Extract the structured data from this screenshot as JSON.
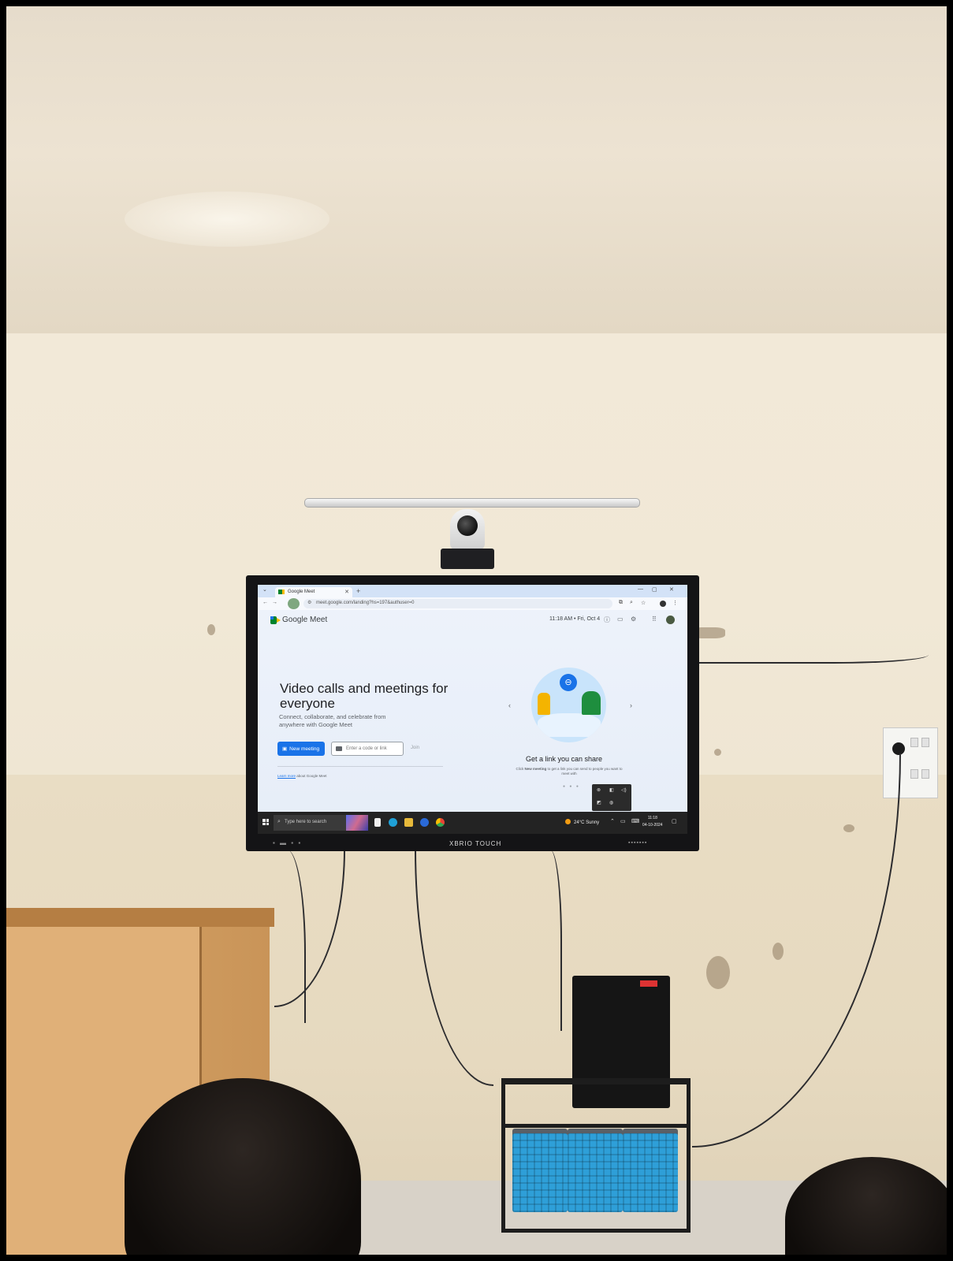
{
  "browser": {
    "tab_title": "Google Meet",
    "url": "meet.google.com/landing?hs=197&authuser=0"
  },
  "meet": {
    "brand": "Google Meet",
    "datetime": "11:18 AM • Fri, Oct 4",
    "hero_title": "Video calls and meetings for everyone",
    "hero_subtitle": "Connect, collaborate, and celebrate from anywhere with Google Meet",
    "new_meeting_label": "New meeting",
    "code_placeholder": "Enter a code or link",
    "join_label": "Join",
    "learn_more_link": "Learn more",
    "learn_more_rest": "about Google Meet",
    "carousel_title": "Get a link you can share",
    "carousel_desc_prefix": "Click ",
    "carousel_desc_bold": "New meeting",
    "carousel_desc_suffix": " to get a link you can send to people you want to meet with"
  },
  "taskbar": {
    "search_placeholder": "Type here to search",
    "weather": "24°C Sunny",
    "time": "11:18",
    "date": "04-10-2024"
  },
  "display": {
    "brand": "XBRIO TOUCH"
  },
  "colors": {
    "meet_blue": "#1a73e8",
    "meet_green": "#00832d",
    "meet_yellow": "#fbbc04",
    "taskbar": "#232323"
  }
}
